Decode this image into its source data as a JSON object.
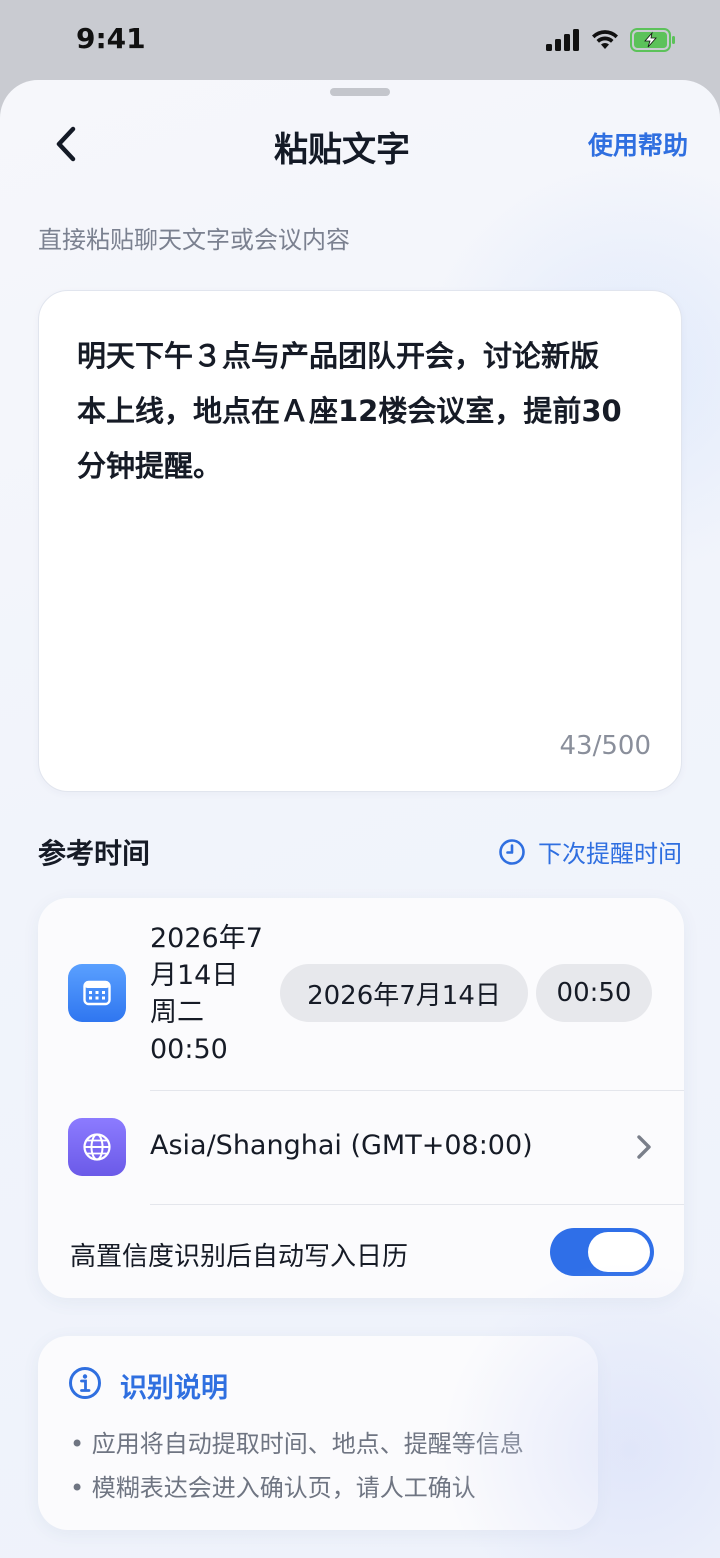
{
  "status_bar": {
    "time": "9:41"
  },
  "nav": {
    "title": "粘贴文字",
    "help": "使用帮助"
  },
  "hint": "直接粘贴聊天文字或会议内容",
  "input": {
    "text": "明天下午３点与产品团队开会，讨论新版本上线，地点在Ａ座12楼会议室，提前30分钟提醒。",
    "counter": "43/500"
  },
  "reference": {
    "title": "参考时间",
    "next_reminder": "下次提醒时间",
    "datetime_label": "2026年7月14日 周二 00:50",
    "date_pill": "2026年7月14日",
    "time_pill": "00:50",
    "timezone": "Asia/Shanghai (GMT+08:00)",
    "auto_write_label": "高置信度识别后自动写入日历",
    "auto_write_enabled": true
  },
  "info": {
    "title": "识别说明",
    "items": [
      "• 应用将自动提取时间、地点、提醒等信息",
      "• 模糊表达会进入确认页，请人工确认"
    ]
  },
  "colors": {
    "accent": "#2f6fe0",
    "calendar_tile": "#3b82f6",
    "globe_tile": "#7c6cf2",
    "toggle_on": "#2f6fe8"
  },
  "icons": [
    "signal-icon",
    "wifi-icon",
    "battery-charging-icon",
    "back-chevron-icon",
    "clock-icon",
    "calendar-icon",
    "globe-icon",
    "chevron-right-icon",
    "info-icon"
  ]
}
